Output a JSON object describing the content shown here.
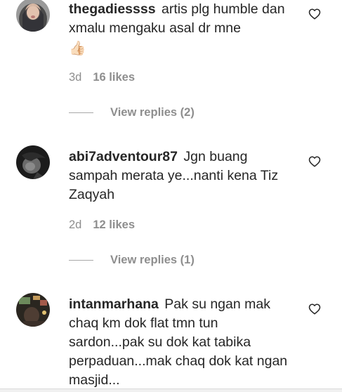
{
  "comments": [
    {
      "username": "thegadiessss",
      "text": "artis plg humble dan xmalu mengaku asal dr mne",
      "emoji": "👍🏻",
      "age": "3d",
      "likes": "16 likes",
      "view_replies": "View replies (2)"
    },
    {
      "username": "abi7adventour87",
      "text": "Jgn buang sampah merata ye...nanti kena Tiz Zaqyah",
      "age": "2d",
      "likes": "12 likes",
      "view_replies": "View replies (1)"
    },
    {
      "username": "intanmarhana",
      "text": "Pak su ngan mak chaq km dok flat tmn tun sardon...pak su dok kat tabika perpaduan...mak chaq dok kat ngan masjid..."
    }
  ],
  "icons": {
    "like": "heart-outline-icon",
    "thumbs_up": "thumbs-up-emoji"
  },
  "colors": {
    "text": "#262626",
    "secondary": "#8e8e8e"
  }
}
